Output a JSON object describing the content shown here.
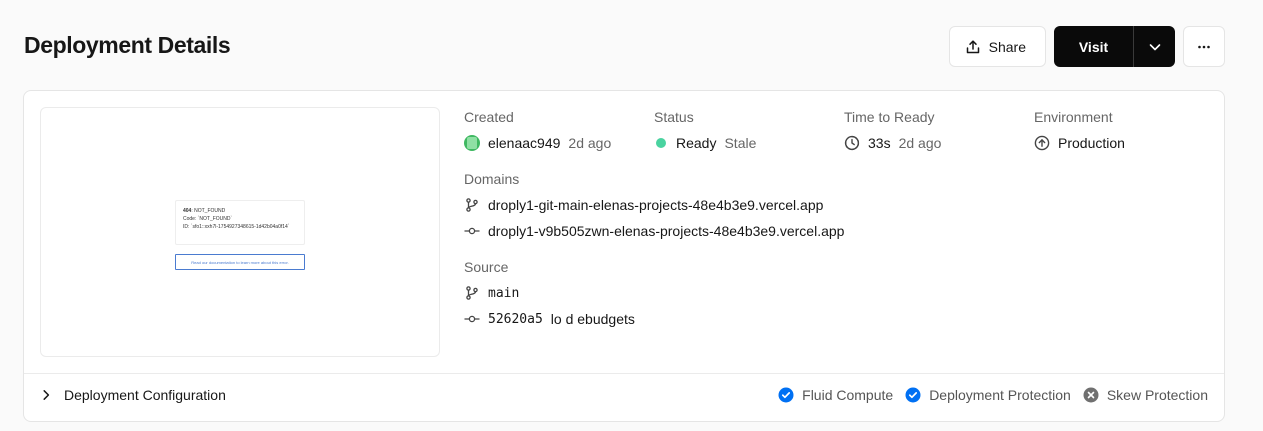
{
  "header": {
    "title": "Deployment Details",
    "share_label": "Share",
    "visit_label": "Visit"
  },
  "preview": {
    "line1_code": "404",
    "line1_text": ": NOT_FOUND",
    "line2": "Code: `NOT_FOUND`",
    "line3": "ID: `sfo1::xxh7l-1754927348615-1d42b04a0f14`",
    "button": "Read our documentation to learn more about this error."
  },
  "created": {
    "label": "Created",
    "user": "elenaac949",
    "time": "2d ago"
  },
  "status": {
    "label": "Status",
    "value": "Ready",
    "extra": "Stale",
    "dot_color": "#4ad3a0"
  },
  "time_to_ready": {
    "label": "Time to Ready",
    "duration": "33s",
    "time": "2d ago"
  },
  "environment": {
    "label": "Environment",
    "value": "Production"
  },
  "domains": {
    "label": "Domains",
    "items": [
      "droply1-git-main-elenas-projects-48e4b3e9.vercel.app",
      "droply1-v9b505zwn-elenas-projects-48e4b3e9.vercel.app"
    ]
  },
  "source": {
    "label": "Source",
    "branch": "main",
    "commit_hash": "52620a5",
    "commit_message": "lo d ebudgets"
  },
  "footer": {
    "config_label": "Deployment Configuration",
    "features": [
      {
        "label": "Fluid Compute",
        "state": "enabled"
      },
      {
        "label": "Deployment Protection",
        "state": "enabled"
      },
      {
        "label": "Skew Protection",
        "state": "disabled"
      }
    ]
  },
  "colors": {
    "accent_blue": "#0070f3",
    "ready_green": "#4ad3a0",
    "primary_dark": "#0a0a0a"
  }
}
